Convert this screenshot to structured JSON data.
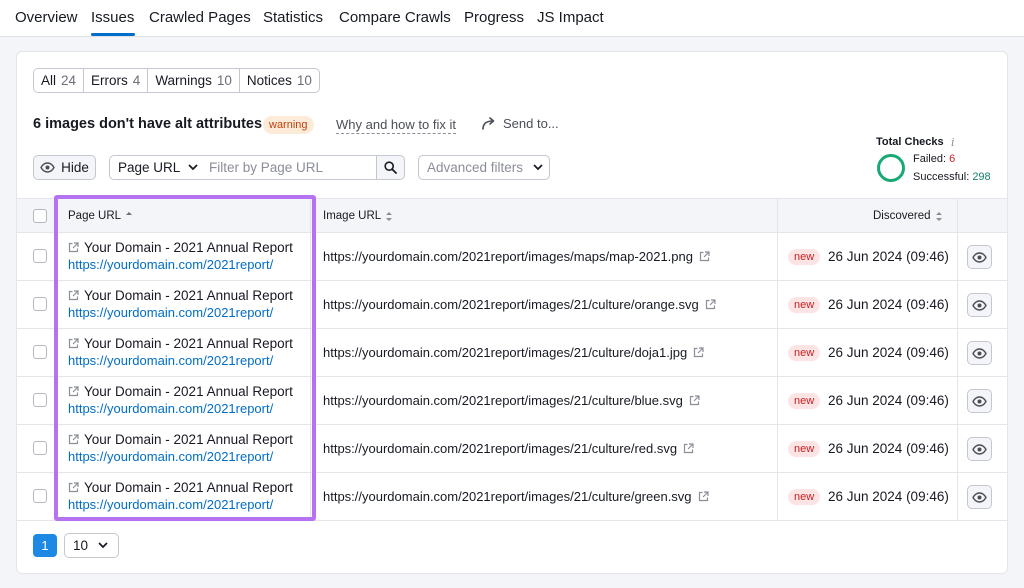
{
  "nav": {
    "tabs": [
      {
        "label": "Overview"
      },
      {
        "label": "Issues"
      },
      {
        "label": "Crawled Pages"
      },
      {
        "label": "Statistics"
      },
      {
        "label": "Compare Crawls"
      },
      {
        "label": "Progress"
      },
      {
        "label": "JS Impact"
      }
    ],
    "active_index": 1
  },
  "filters": [
    {
      "label": "All",
      "count": "24"
    },
    {
      "label": "Errors",
      "count": "4"
    },
    {
      "label": "Warnings",
      "count": "10"
    },
    {
      "label": "Notices",
      "count": "10"
    }
  ],
  "issue": {
    "title": "6 images don't have alt attributes",
    "badge": "warning",
    "why_link": "Why and how to fix it",
    "send_label": "Send to..."
  },
  "total_checks": {
    "title": "Total Checks",
    "info": "i",
    "failed_label": "Failed:",
    "failed_value": "6",
    "successful_label": "Successful:",
    "successful_value": "298"
  },
  "controls": {
    "hide_label": "Hide",
    "select_label": "Page URL",
    "filter_placeholder": "Filter by Page URL",
    "advanced_label": "Advanced filters"
  },
  "table": {
    "columns": {
      "page_url": "Page URL",
      "image_url": "Image URL",
      "discovered": "Discovered"
    },
    "rows": [
      {
        "title": "Your Domain - 2021 Annual Report",
        "page_url": "https://yourdomain.com/2021report/",
        "image_url": "https://yourdomain.com/2021report/images/maps/map-2021.png",
        "badge": "new",
        "date": "26 Jun 2024 (09:46)"
      },
      {
        "title": "Your Domain - 2021 Annual Report",
        "page_url": "https://yourdomain.com/2021report/",
        "image_url": "https://yourdomain.com/2021report/images/21/culture/orange.svg",
        "badge": "new",
        "date": "26 Jun 2024 (09:46)"
      },
      {
        "title": "Your Domain - 2021 Annual Report",
        "page_url": "https://yourdomain.com/2021report/",
        "image_url": "https://yourdomain.com/2021report/images/21/culture/doja1.jpg",
        "badge": "new",
        "date": "26 Jun 2024 (09:46)"
      },
      {
        "title": "Your Domain - 2021 Annual Report",
        "page_url": "https://yourdomain.com/2021report/",
        "image_url": "https://yourdomain.com/2021report/images/21/culture/blue.svg",
        "badge": "new",
        "date": "26 Jun 2024 (09:46)"
      },
      {
        "title": "Your Domain - 2021 Annual Report",
        "page_url": "https://yourdomain.com/2021report/",
        "image_url": "https://yourdomain.com/2021report/images/21/culture/red.svg",
        "badge": "new",
        "date": "26 Jun 2024 (09:46)"
      },
      {
        "title": "Your Domain - 2021 Annual Report",
        "page_url": "https://yourdomain.com/2021report/",
        "image_url": "https://yourdomain.com/2021report/images/21/culture/green.svg",
        "badge": "new",
        "date": "26 Jun 2024 (09:46)"
      }
    ]
  },
  "pagination": {
    "current_page": "1",
    "page_size": "10"
  },
  "colors": {
    "accent": "#006dca",
    "highlight": "#b573f2",
    "success": "#19a974",
    "failed": "#d1232a"
  }
}
